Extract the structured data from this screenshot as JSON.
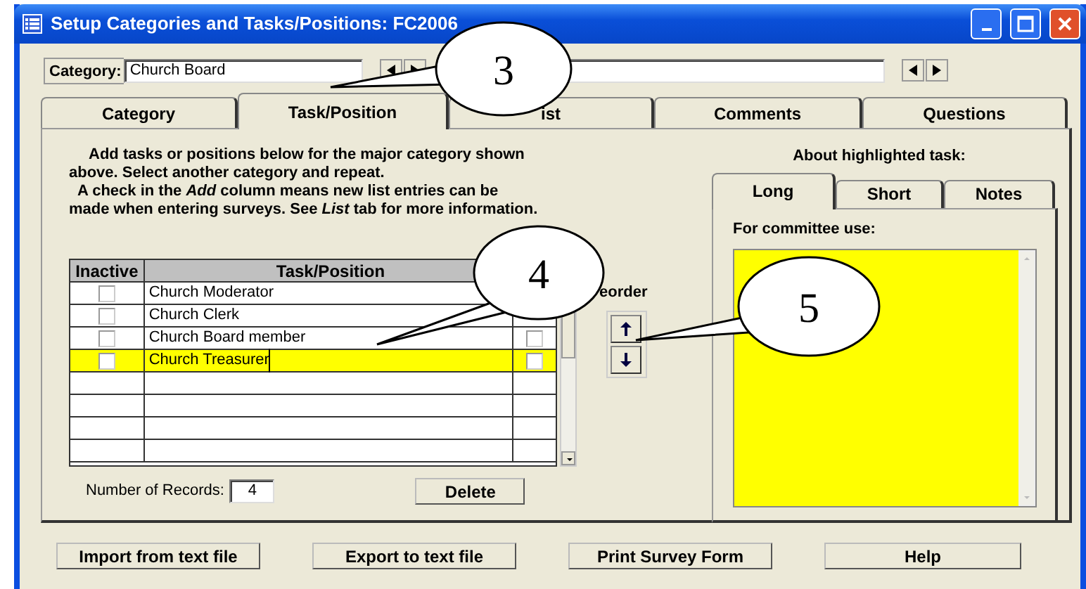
{
  "window": {
    "title": "Setup Categories and Tasks/Positions: FC2006"
  },
  "category_bar": {
    "label": "Category:",
    "value": "Church Board"
  },
  "tabs": [
    {
      "label": "Category",
      "selected": false
    },
    {
      "label": "Task/Position",
      "selected": true
    },
    {
      "label": "ist",
      "selected": false
    },
    {
      "label": "Comments",
      "selected": false
    },
    {
      "label": "Questions",
      "selected": false
    }
  ],
  "instructions": [
    "Add tasks or positions below for the major category shown above.  Select another category and repeat.",
    "A check in the *Add* column means new list entries can be made when entering surveys.  See *List* tab for more information."
  ],
  "table": {
    "columns": [
      "Inactive",
      "Task/Position"
    ],
    "rows": [
      {
        "inactive": false,
        "task": "Church Moderator",
        "selected": false
      },
      {
        "inactive": false,
        "task": "Church Clerk",
        "selected": false
      },
      {
        "inactive": false,
        "task": "Church Board member",
        "add": false,
        "selected": false
      },
      {
        "inactive": false,
        "task": "Church Treasurer",
        "add": false,
        "selected": true
      }
    ]
  },
  "reorder": {
    "label": "eorder"
  },
  "records": {
    "label": "Number of Records:",
    "value": "4"
  },
  "delete_button": "Delete",
  "details": {
    "heading": "About highlighted task:",
    "tabs": [
      {
        "label": "Long",
        "selected": true
      },
      {
        "label": "Short",
        "selected": false
      },
      {
        "label": "Notes",
        "selected": false
      }
    ],
    "field_label": "For committee use:"
  },
  "buttons": [
    "Import from text file",
    "Export to text file",
    "Print Survey Form",
    "Help"
  ],
  "callouts": [
    {
      "number": "3"
    },
    {
      "number": "4"
    },
    {
      "number": "5"
    }
  ]
}
